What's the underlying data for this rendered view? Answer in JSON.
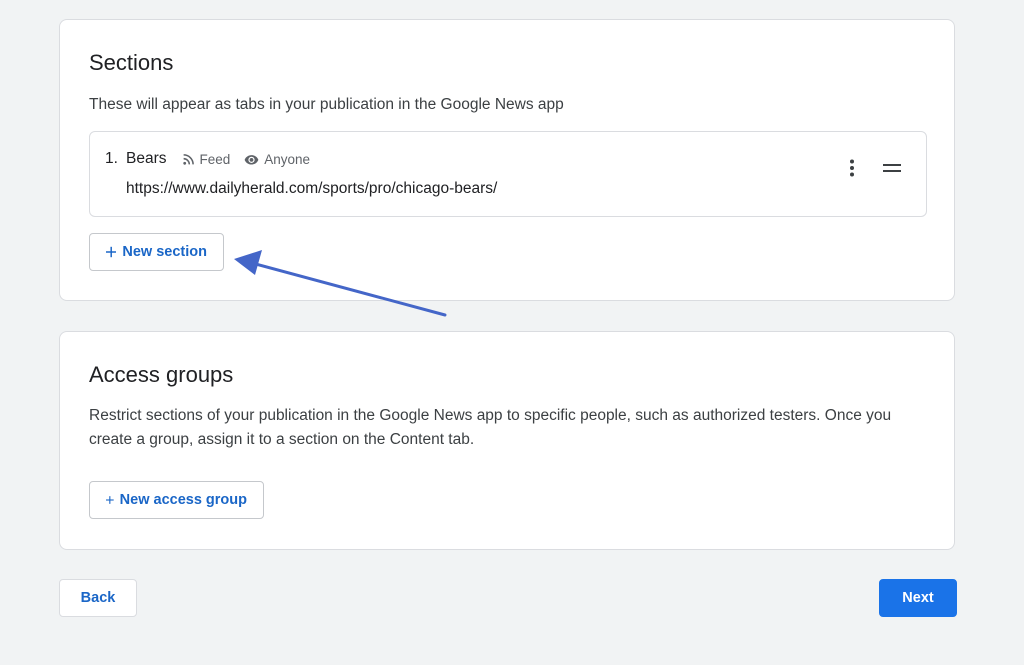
{
  "sections_card": {
    "title": "Sections",
    "description": "These will appear as tabs in your publication in the Google News app",
    "items": [
      {
        "number": "1.",
        "name": "Bears",
        "type_label": "Feed",
        "visibility_label": "Anyone",
        "url": "https://www.dailyherald.com/sports/pro/chicago-bears/"
      }
    ],
    "new_button_label": "New section"
  },
  "access_card": {
    "title": "Access groups",
    "description": "Restrict sections of your publication in the Google News app to specific people, such as authorized testers. Once you create a group, assign it to a section on the Content tab.",
    "new_button_label": "New access group"
  },
  "footer": {
    "back_label": "Back",
    "next_label": "Next"
  },
  "icons": {
    "feed": "rss-feed-icon",
    "visibility": "eye-icon",
    "more": "more-vert-icon",
    "drag": "drag-handle-icon",
    "add": "plus-icon",
    "annotation": "arrow-annotation"
  },
  "colors": {
    "accent": "#1a73e8",
    "link_text": "#1a66c7",
    "annotation_arrow": "#4466c8",
    "background": "#f1f3f4"
  }
}
